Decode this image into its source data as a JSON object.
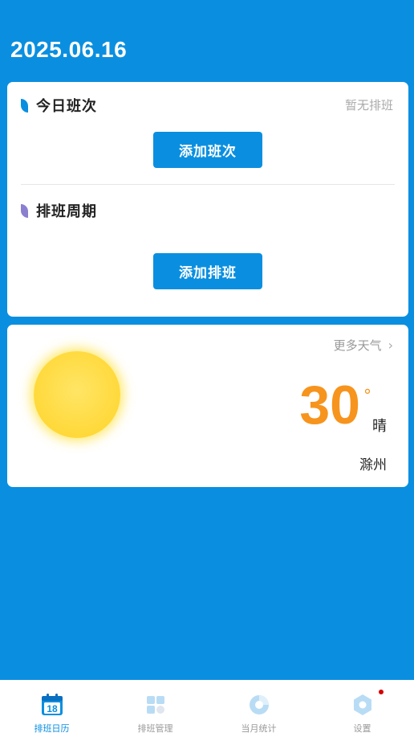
{
  "header": {
    "date": "2025.06.16"
  },
  "today_shift": {
    "title": "今日班次",
    "status": "暂无排班",
    "add_button": "添加班次",
    "accent": "#0a8fe0"
  },
  "shift_cycle": {
    "title": "排班周期",
    "add_button": "添加排班",
    "accent": "#8b7fd0"
  },
  "weather": {
    "more_label": "更多天气",
    "more_icon": "chevron-right-icon",
    "temperature": "30",
    "degree_symbol": "°",
    "condition": "晴",
    "city": "滁州",
    "icon": "sun-icon"
  },
  "tabbar": {
    "items": [
      {
        "label": "排班日历",
        "icon": "calendar-icon",
        "badge": "18",
        "active": true
      },
      {
        "label": "排班管理",
        "icon": "grid-icon",
        "active": false
      },
      {
        "label": "当月统计",
        "icon": "pie-chart-icon",
        "active": false
      },
      {
        "label": "设置",
        "icon": "hexagon-settings-icon",
        "active": false,
        "has_dot": true
      }
    ]
  },
  "colors": {
    "primary": "#0a8fe0",
    "temperature": "#f7941d",
    "tab_inactive_icon": "#b9dcf5",
    "notification_dot": "#d50000"
  }
}
